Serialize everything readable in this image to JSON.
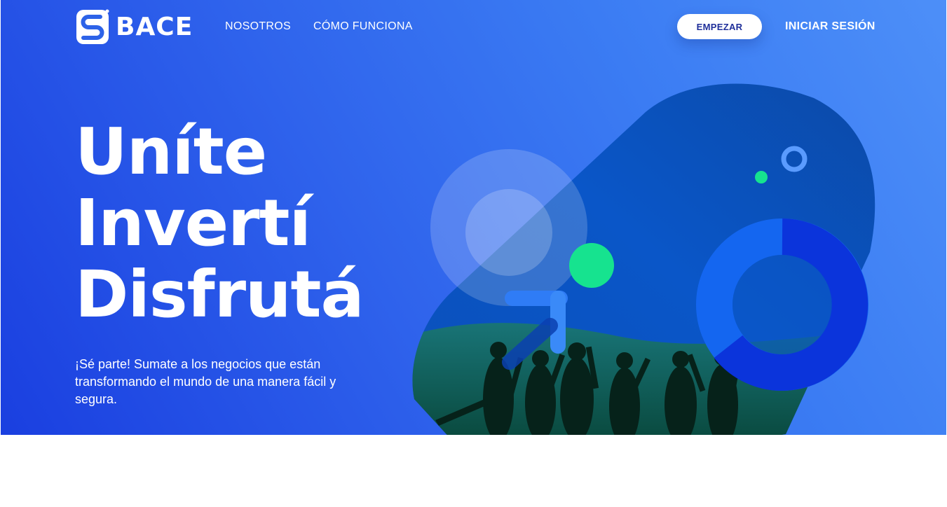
{
  "brand": {
    "name": "BACE"
  },
  "nav": {
    "links": [
      "NOSOTROS",
      "CÓMO FUNCIONA"
    ],
    "cta_label": "EMPEZAR",
    "login_label": "INICIAR SESIÓN"
  },
  "hero": {
    "headline": [
      "Uníte",
      "Invertí",
      "Disfrutá"
    ],
    "subtitle": "¡Sé parte! Sumate a los negocios que están transformando el mundo de una manera fácil y segura."
  },
  "icons": [
    "bace-logo-icon"
  ],
  "colors": {
    "hero_gradient_start": "#1a3fe0",
    "hero_gradient_end": "#4d8ff8",
    "accent_green": "#16e38f",
    "cta_text": "#1f2f9a"
  }
}
